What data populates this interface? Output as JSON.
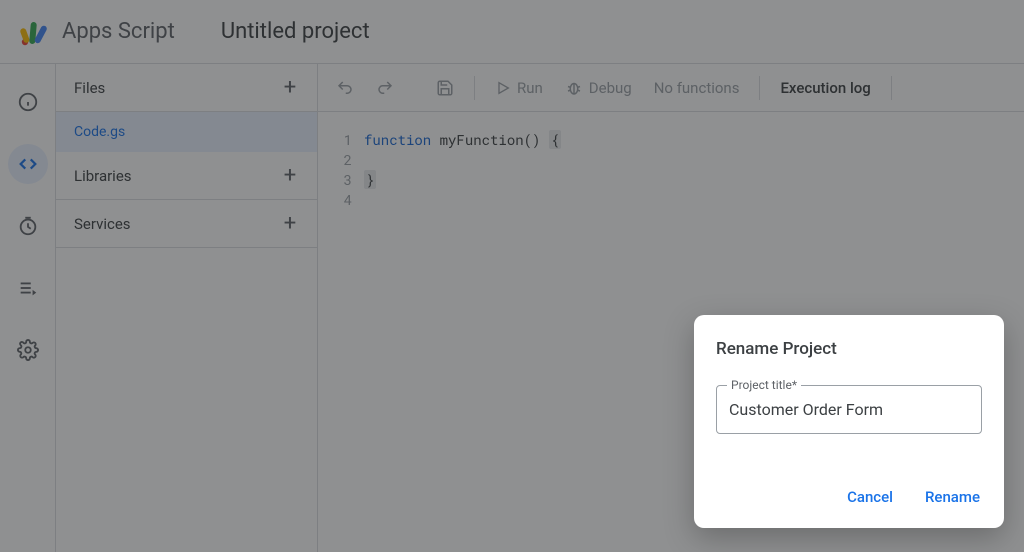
{
  "brand": "Apps Script",
  "project_title": "Untitled project",
  "files_panel": {
    "files_label": "Files",
    "libraries_label": "Libraries",
    "services_label": "Services",
    "active_file": "Code.gs"
  },
  "toolbar": {
    "run": "Run",
    "debug": "Debug",
    "no_functions": "No functions",
    "execution_log": "Execution log"
  },
  "editor": {
    "gutter": [
      "1",
      "2",
      "3",
      "4"
    ],
    "code": {
      "keyword_function": "function",
      "space1": " ",
      "fn_name": "myFunction",
      "parens": "()",
      "space2": " ",
      "open_brace": "{",
      "line2": "  ",
      "close_brace": "}",
      "line4": ""
    }
  },
  "dialog": {
    "title": "Rename Project",
    "field_label": "Project title*",
    "input_value": "Customer Order Form",
    "cancel": "Cancel",
    "rename": "Rename"
  }
}
